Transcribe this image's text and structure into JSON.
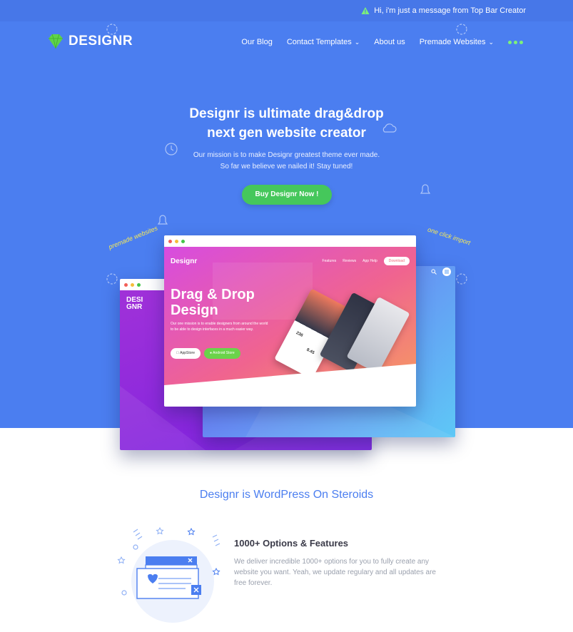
{
  "topbar": {
    "message": "Hi, i'm just a message from Top Bar Creator"
  },
  "brand": {
    "name": "DESIGNR"
  },
  "nav": {
    "items": [
      {
        "label": "Our Blog",
        "dropdown": false
      },
      {
        "label": "Contact Templates",
        "dropdown": true
      },
      {
        "label": "About us",
        "dropdown": false
      },
      {
        "label": "Premade Websites",
        "dropdown": true
      }
    ]
  },
  "hero": {
    "title_line1": "Designr is ultimate drag&drop",
    "title_line2": "next gen website creator",
    "subtitle_line1": "Our mission is to make Designr greatest theme ever made.",
    "subtitle_line2": "So far we believe we nailed it! Stay tuned!",
    "cta": "Buy Designr Now !",
    "hand_left": "premade websites",
    "hand_right": "one click import"
  },
  "mockup": {
    "logo": "Designr",
    "nav": [
      "Features",
      "Reviews",
      "App Help"
    ],
    "download": "Download",
    "headline_line1": "Drag & Drop",
    "headline_line2": "Design",
    "text": "Our one mission is to enable designers from around the world to be able to design interfaces in a much easier way.",
    "appstore": "AppStore",
    "android": "Android Store",
    "back_logo_line1": "DESI",
    "back_logo_line2": "GNR",
    "phone_val1": "236",
    "phone_val2": "8.45"
  },
  "section": {
    "title": "Designr is WordPress On Steroids",
    "feature_title": "1000+ Options & Features",
    "feature_text": "We deliver incredible 1000+ options for you to fully create any website you want. Yeah, we update regulary and all updates are free forever."
  },
  "colors": {
    "hero_bg": "#4b7ef0",
    "topbar_bg": "#4777e8",
    "cta_green": "#45c75b",
    "accent_blue": "#4b7ef0",
    "nav_dots": "#7df07a"
  }
}
